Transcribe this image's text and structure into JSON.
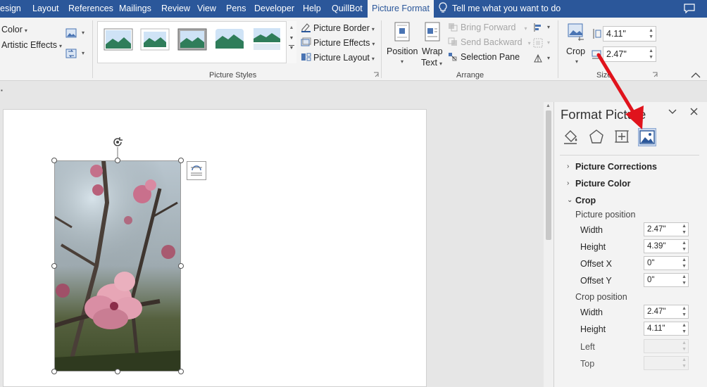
{
  "tabs": [
    {
      "label": "esign",
      "active": false
    },
    {
      "label": "Layout",
      "active": false
    },
    {
      "label": "References",
      "active": false
    },
    {
      "label": "Mailings",
      "active": false
    },
    {
      "label": "Review",
      "active": false
    },
    {
      "label": "View",
      "active": false
    },
    {
      "label": "Pens",
      "active": false
    },
    {
      "label": "Developer",
      "active": false
    },
    {
      "label": "Help",
      "active": false
    },
    {
      "label": "QuillBot",
      "active": false
    },
    {
      "label": "Picture Format",
      "active": true
    }
  ],
  "tell_me": "Tell me what you want to do",
  "ribbon": {
    "adjust": {
      "color": "Color",
      "artistic_effects": "Artistic Effects"
    },
    "picture_styles": {
      "group_label": "Picture Styles",
      "picture_border": "Picture Border",
      "picture_effects": "Picture Effects",
      "picture_layout": "Picture Layout"
    },
    "arrange": {
      "group_label": "Arrange",
      "position": "Position",
      "wrap_text_line1": "Wrap",
      "wrap_text_line2": "Text",
      "bring_forward": "Bring Forward",
      "send_backward": "Send Backward",
      "selection_pane": "Selection Pane"
    },
    "size": {
      "group_label": "Size",
      "crop": "Crop",
      "height_value": "4.11\"",
      "width_value": "2.47\""
    }
  },
  "pane": {
    "title": "Format Picture",
    "icons": [
      "fill-line-icon",
      "effects-icon",
      "layout-properties-icon",
      "picture-icon"
    ],
    "selected_icon": "picture-icon",
    "sections": {
      "picture_corrections": "Picture Corrections",
      "picture_color": "Picture Color",
      "crop": "Crop"
    },
    "picture_position": {
      "heading": "Picture position",
      "width_label": "Width",
      "width_value": "2.47\"",
      "height_label": "Height",
      "height_value": "4.39\"",
      "offset_x_label": "Offset X",
      "offset_x_value": "0\"",
      "offset_y_label": "Offset Y",
      "offset_y_value": "0\""
    },
    "crop_position": {
      "heading": "Crop position",
      "width_label": "Width",
      "width_value": "2.47\"",
      "height_label": "Height",
      "height_value": "4.11\"",
      "left_label": "Left",
      "left_value": "",
      "top_label": "Top",
      "top_value": ""
    }
  },
  "colors": {
    "accent": "#2b579a",
    "arrow": "#e0131c"
  }
}
